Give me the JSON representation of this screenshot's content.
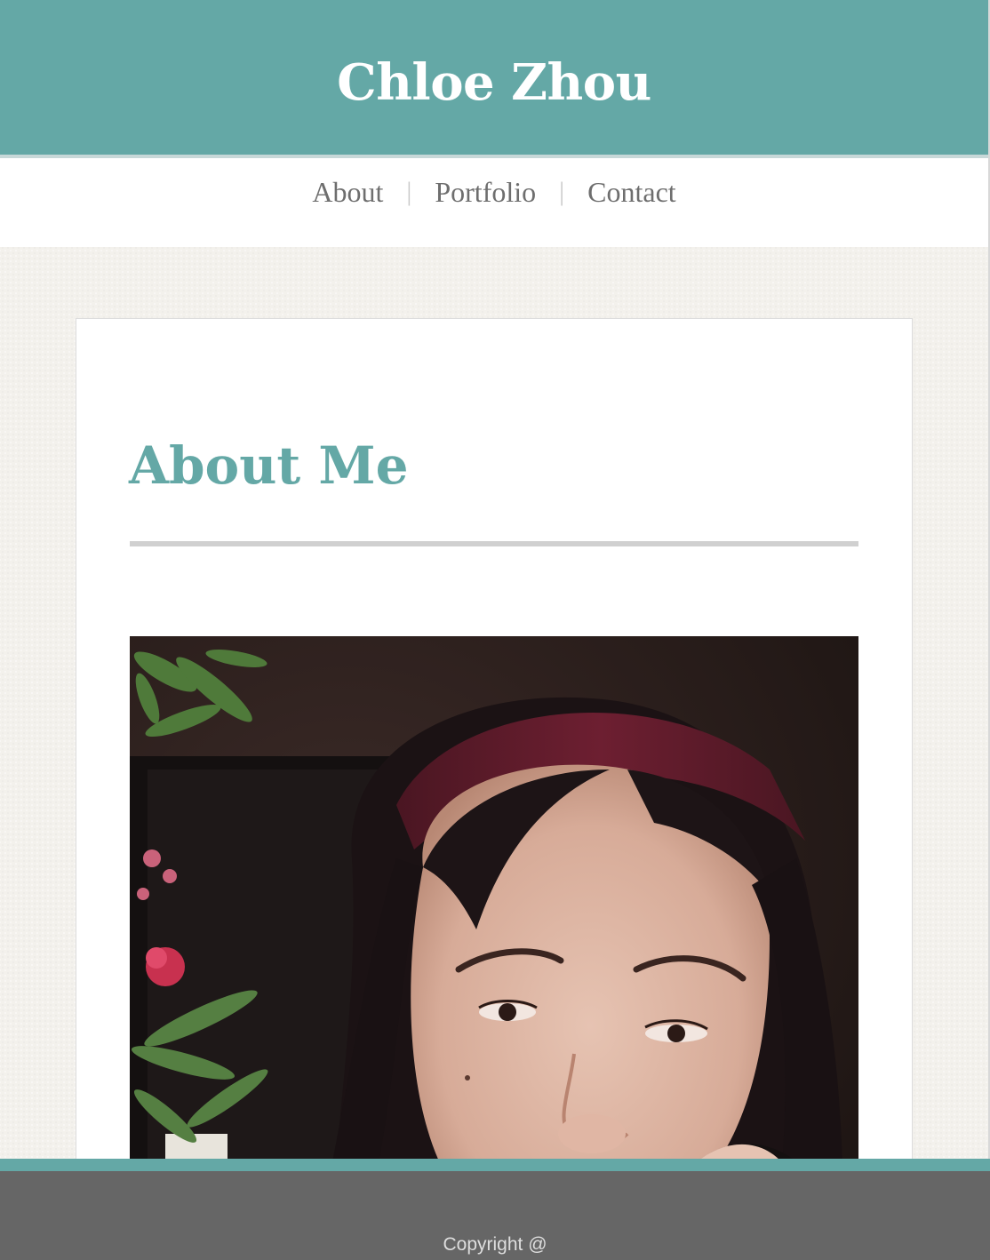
{
  "header": {
    "site_title": "Chloe Zhou"
  },
  "nav": {
    "items": [
      {
        "label": "About"
      },
      {
        "label": "Portfolio"
      },
      {
        "label": "Contact"
      }
    ],
    "separator": "|"
  },
  "main": {
    "section_title": "About Me",
    "photo_alt": "portrait photo"
  },
  "footer": {
    "copyright": "Copyright @"
  },
  "colors": {
    "accent": "#64a8a6",
    "background": "#f3f1ec",
    "footer": "#666666",
    "nav_text": "#6e6e6e"
  }
}
